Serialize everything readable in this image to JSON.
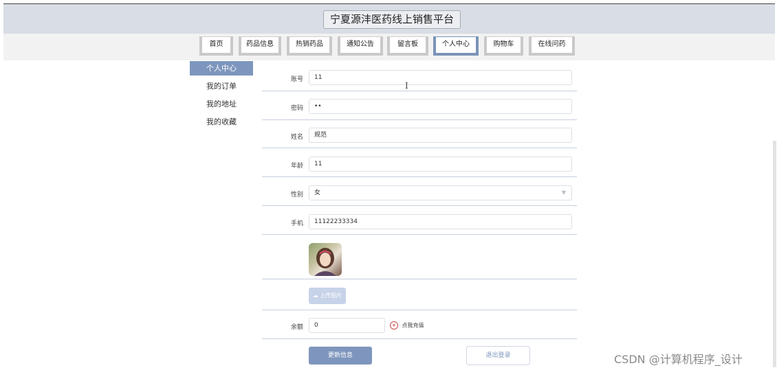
{
  "header": {
    "site_title": "宁夏源沣医药线上销售平台"
  },
  "nav": {
    "items": [
      {
        "label": "首页"
      },
      {
        "label": "药品信息"
      },
      {
        "label": "热销药品"
      },
      {
        "label": "通知公告"
      },
      {
        "label": "留言板"
      },
      {
        "label": "个人中心"
      },
      {
        "label": "购物车"
      },
      {
        "label": "在线问药"
      }
    ],
    "active": "个人中心"
  },
  "sidebar": {
    "items": [
      {
        "label": "个人中心"
      },
      {
        "label": "我的订单"
      },
      {
        "label": "我的地址"
      },
      {
        "label": "我的收藏"
      }
    ]
  },
  "form": {
    "account": {
      "label": "账号",
      "value": "11"
    },
    "password": {
      "label": "密码",
      "value": "••"
    },
    "name": {
      "label": "姓名",
      "value": "规范"
    },
    "age": {
      "label": "年龄",
      "value": "11"
    },
    "gender": {
      "label": "性别",
      "value": "女"
    },
    "phone": {
      "label": "手机",
      "value": "11122233334"
    },
    "upload_label": "上传图片",
    "balance": {
      "label": "余额",
      "value": "0"
    },
    "recharge_label": "点我充值"
  },
  "actions": {
    "update_label": "更新信息",
    "logout_label": "退出登录"
  },
  "watermark": "CSDN @计算机程序_设计",
  "colors": {
    "accent": "#7e96bd",
    "header_bg": "#d9dde5"
  }
}
